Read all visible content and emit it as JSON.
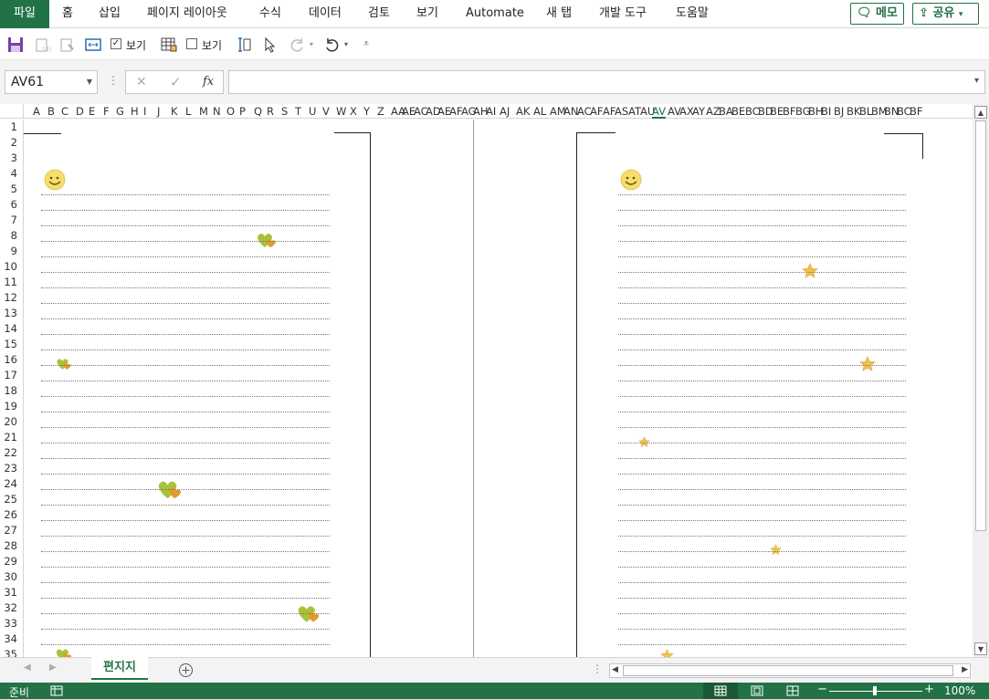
{
  "ribbon": {
    "file": "파일",
    "tabs": [
      "홈",
      "삽입",
      "페이지 레이아웃",
      "수식",
      "데이터",
      "검토",
      "보기",
      "Automate",
      "새 탭",
      "개발 도구",
      "도움말"
    ],
    "memo": "메모",
    "share": "공유"
  },
  "quickbar": {
    "view1": "보기",
    "view2": "보기"
  },
  "formula_bar": {
    "name_box": "AV61",
    "fx": "fx",
    "cancel": "✕",
    "confirm": "✓",
    "value": ""
  },
  "columns": [
    "A",
    "B",
    "C",
    "D",
    "E",
    "F",
    "G",
    "H",
    "I",
    "J",
    "K",
    "L",
    "M",
    "N",
    "O",
    "P",
    "Q",
    "R",
    "S",
    "T",
    "U",
    "V",
    "W",
    "X",
    "Y",
    "Z",
    "AA",
    "AE",
    "AC",
    "AD",
    "AE",
    "AF",
    "AG",
    "AH",
    "AI",
    "AJ",
    "AK",
    "AL",
    "AM",
    "AN",
    "AC",
    "AF",
    "AF",
    "AS",
    "AT",
    "AU",
    "AV",
    "AV",
    "AX",
    "AY",
    "AZ",
    "BA",
    "BE",
    "BC",
    "BD",
    "BE",
    "BF",
    "BG",
    "BH",
    "BI",
    "BJ",
    "BK",
    "BL",
    "BM",
    "BN",
    "BC",
    "BF"
  ],
  "selected_column": "AV",
  "rows": [
    "1",
    "2",
    "3",
    "4",
    "5",
    "6",
    "7",
    "8",
    "9",
    "10",
    "11",
    "12",
    "13",
    "14",
    "15",
    "16",
    "17",
    "18",
    "19",
    "20",
    "21",
    "22",
    "23",
    "24",
    "25",
    "26",
    "27",
    "28",
    "29",
    "30",
    "31",
    "32",
    "33",
    "34",
    "35"
  ],
  "sheet": {
    "tab_name": "편지지",
    "decor_left": [
      "smiley-icon",
      "heart-leaf-icon",
      "heart-leaf-icon",
      "heart-leaf-icon",
      "heart-leaf-icon",
      "heart-leaf-icon"
    ],
    "decor_right": [
      "smiley-icon",
      "star-icon",
      "star-icon",
      "star-icon",
      "star-icon",
      "star-icon"
    ]
  },
  "status": {
    "ready": "준비",
    "zoom": "100%"
  },
  "colors": {
    "accent": "#217346",
    "star": "#f2c14e",
    "leaf": "#a8c23a",
    "leaf_orange": "#e39a2d"
  }
}
